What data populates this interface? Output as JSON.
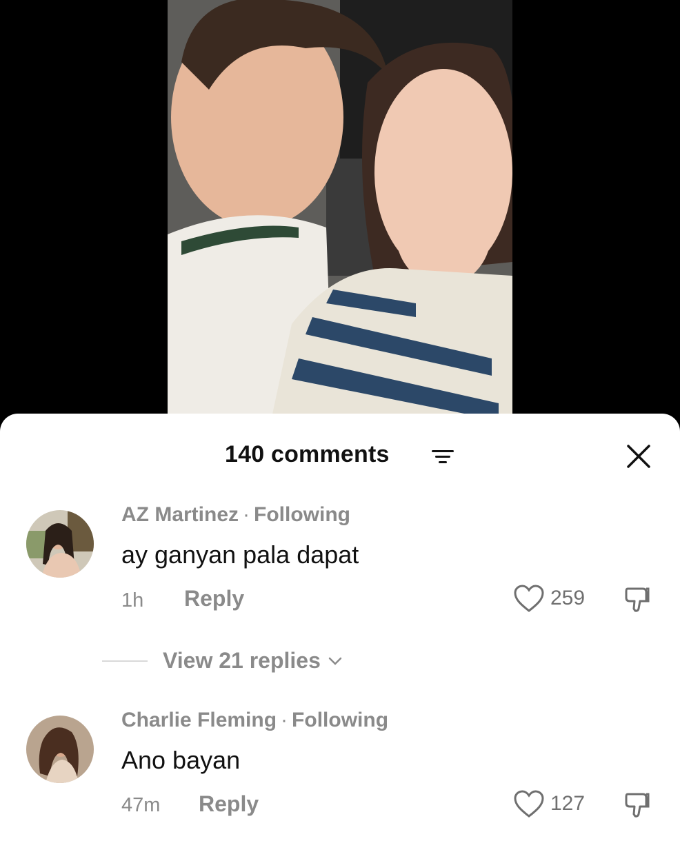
{
  "video": {
    "icon": "video-frame-image"
  },
  "sheet": {
    "count_label": "140 comments",
    "sort_icon": "sort-icon",
    "close_icon": "close-icon"
  },
  "comments": [
    {
      "username": "AZ Martinez",
      "separator": "·",
      "relation": "Following",
      "text": "ay ganyan pala dapat",
      "time": "1h",
      "reply_label": "Reply",
      "likes": "259",
      "view_replies": "View 21 replies"
    },
    {
      "username": "Charlie Fleming",
      "separator": "·",
      "relation": "Following",
      "text": "Ano bayan",
      "time": "47m",
      "reply_label": "Reply",
      "likes": "127"
    }
  ],
  "colors": {
    "text_primary": "#111111",
    "text_secondary": "#8a8a8a",
    "sheet_bg": "#ffffff",
    "page_bg": "#000000"
  }
}
